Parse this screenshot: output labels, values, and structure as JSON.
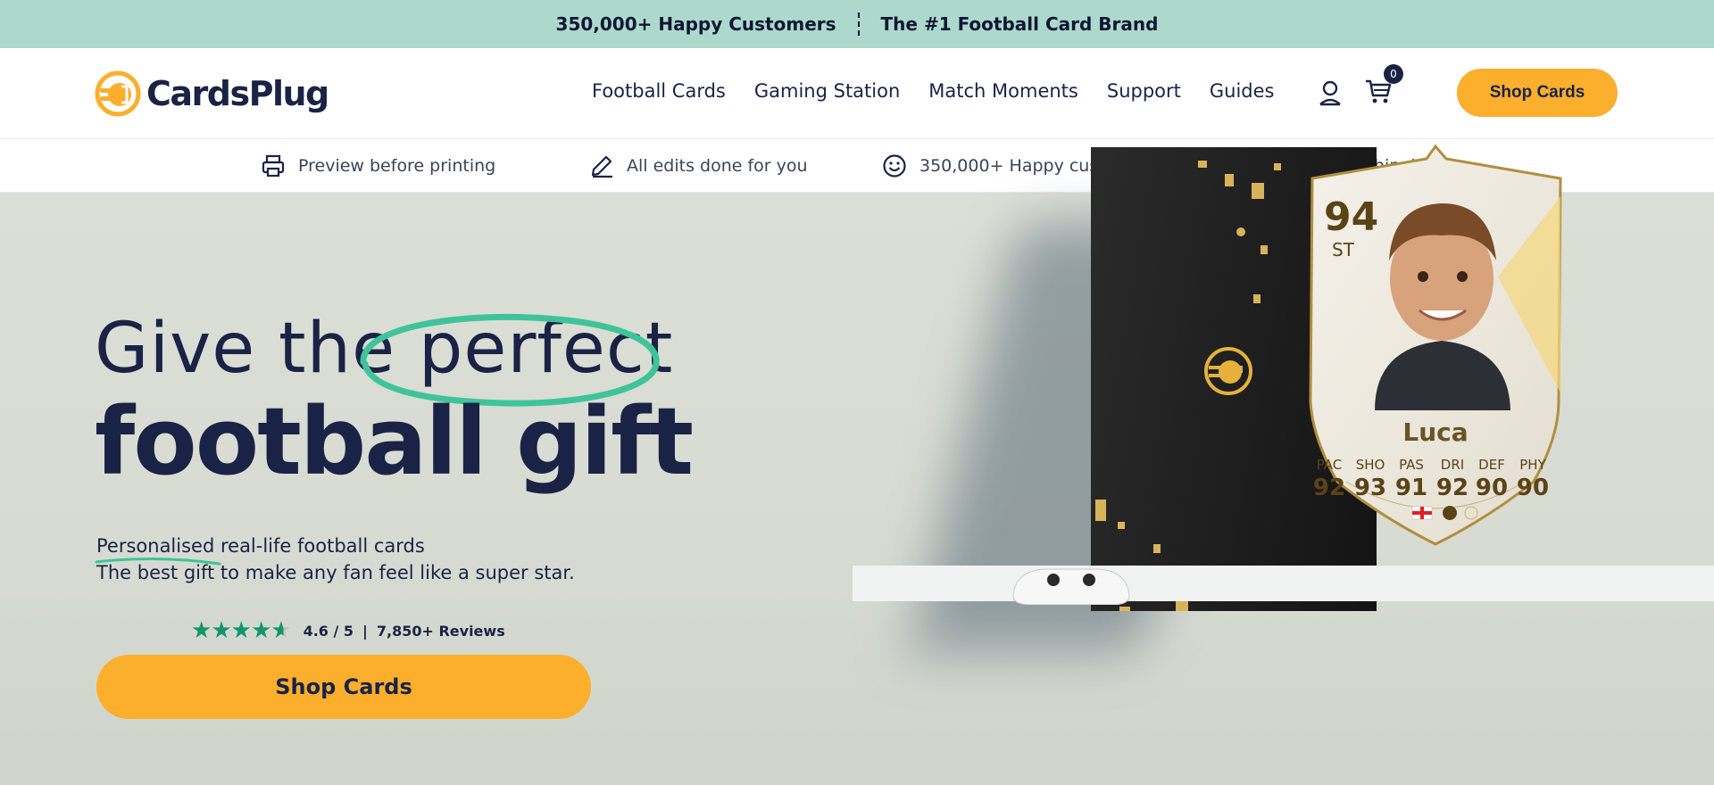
{
  "announcement": {
    "left": "350,000+ Happy Customers",
    "right": "The #1 Football Card Brand"
  },
  "header": {
    "logo_text": "CardsPlug",
    "nav": [
      "Football Cards",
      "Gaming Station",
      "Match Moments",
      "Support",
      "Guides"
    ],
    "cart_count": "0",
    "shop_button": "Shop Cards"
  },
  "usp": [
    {
      "icon": "printer-icon",
      "label": "Preview before printing"
    },
    {
      "icon": "pencil-icon",
      "label": "All edits done for you"
    },
    {
      "icon": "smiley-icon",
      "label": "350,000+ Happy customers"
    },
    {
      "icon": "plane-icon",
      "label": "Worldwide shipping"
    }
  ],
  "hero": {
    "title_line1_a": "Give the ",
    "title_line1_b": "perfect",
    "title_line2": "football gift",
    "sub_highlight": "Personalised",
    "sub_rest": " real-life football cards",
    "sub_line2": "The best gift to make any fan feel like a super star.",
    "rating_value": "4.6 / 5",
    "rating_sep": "|",
    "reviews_count": "7,850+",
    "reviews_label": "Reviews",
    "star_rating": 4.6,
    "shop_button": "Shop Cards"
  },
  "card": {
    "overall": "94",
    "position": "ST",
    "name": "Luca",
    "stats": [
      {
        "label": "PAC",
        "value": "92"
      },
      {
        "label": "SHO",
        "value": "93"
      },
      {
        "label": "PAS",
        "value": "91"
      },
      {
        "label": "DRI",
        "value": "92"
      },
      {
        "label": "DEF",
        "value": "90"
      },
      {
        "label": "PHY",
        "value": "90"
      }
    ]
  },
  "colors": {
    "announce_bg": "#acd9cc",
    "accent_orange": "#fcae2d",
    "navy": "#1a2346",
    "highlight_green": "#3fc49a",
    "star_green": "#14956d"
  }
}
